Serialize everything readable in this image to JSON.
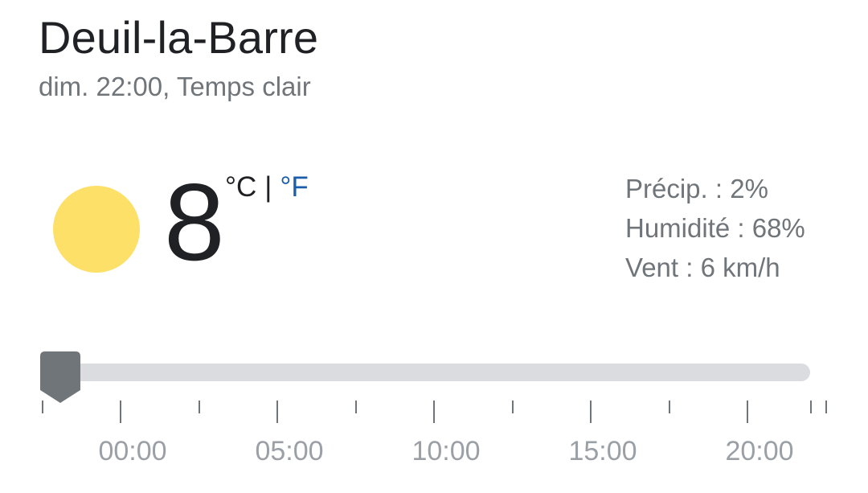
{
  "location": "Deuil-la-Barre",
  "subtitle": "dim. 22:00, Temps clair",
  "weather": {
    "icon": "sun-icon",
    "icon_color": "#fde068",
    "temperature": "8",
    "unit_celsius": "°C",
    "unit_separator": "|",
    "unit_fahrenheit": "°F",
    "active_unit_color": "#202124",
    "link_color": "#1a5dab"
  },
  "details": {
    "precipitation": "Précip. : 2%",
    "humidity": "Humidité : 68%",
    "wind": "Vent : 6 km/h"
  },
  "timeline": {
    "labels": [
      "00:00",
      "05:00",
      "10:00",
      "15:00",
      "20:00"
    ],
    "selected_time": "22:00",
    "track_color": "#dadce0",
    "handle_color": "#70757a"
  }
}
